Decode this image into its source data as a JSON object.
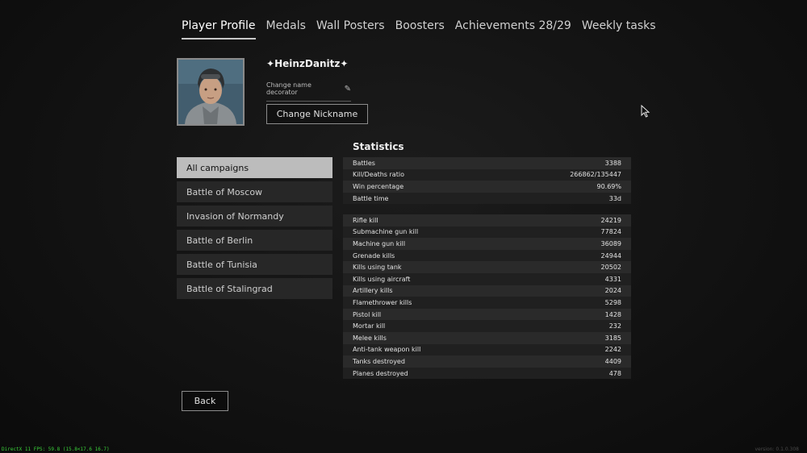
{
  "tabs": [
    {
      "label": "Player Profile"
    },
    {
      "label": "Medals"
    },
    {
      "label": "Wall Posters"
    },
    {
      "label": "Boosters"
    },
    {
      "label": "Achievements 28/29"
    },
    {
      "label": "Weekly tasks"
    }
  ],
  "active_tab": "Player Profile",
  "profile": {
    "nickname": "HeinzDanitz",
    "decorator_label": "Change name decorator",
    "change_nickname_label": "Change Nickname"
  },
  "campaigns": [
    {
      "label": "All campaigns"
    },
    {
      "label": "Battle of Moscow"
    },
    {
      "label": "Invasion of Normandy"
    },
    {
      "label": "Battle of Berlin"
    },
    {
      "label": "Battle of Tunisia"
    },
    {
      "label": "Battle of Stalingrad"
    }
  ],
  "selected_campaign": "All campaigns",
  "statistics": {
    "title": "Statistics",
    "summary": [
      {
        "label": "Battles",
        "value": "3388"
      },
      {
        "label": "Kill/Deaths ratio",
        "value": "266862/135447"
      },
      {
        "label": "Win percentage",
        "value": "90.69%"
      },
      {
        "label": "Battle time",
        "value": "33d"
      }
    ],
    "kills": [
      {
        "label": "Rifle kill",
        "value": "24219"
      },
      {
        "label": "Submachine gun kill",
        "value": "77824"
      },
      {
        "label": "Machine gun kill",
        "value": "36089"
      },
      {
        "label": "Grenade kills",
        "value": "24944"
      },
      {
        "label": "Kills using tank",
        "value": "20502"
      },
      {
        "label": "Kills using aircraft",
        "value": "4331"
      },
      {
        "label": "Artillery kills",
        "value": "2024"
      },
      {
        "label": "Flamethrower kills",
        "value": "5298"
      },
      {
        "label": "Pistol kill",
        "value": "1428"
      },
      {
        "label": "Mortar kill",
        "value": "232"
      },
      {
        "label": "Melee kills",
        "value": "3185"
      },
      {
        "label": "Anti-tank weapon kill",
        "value": "2242"
      },
      {
        "label": "Tanks destroyed",
        "value": "4409"
      },
      {
        "label": "Planes destroyed",
        "value": "478"
      }
    ]
  },
  "back_label": "Back",
  "debug": {
    "fps_text": "DirectX 11 FPS: 59.8 (15.8<17.6 16.7)",
    "version_text": "version: 0.1.0.308"
  },
  "icons": {
    "nickname_decorator": "wing-icon",
    "decorator_edit": "pencil-icon",
    "cursor": "mouse-pointer-icon"
  }
}
